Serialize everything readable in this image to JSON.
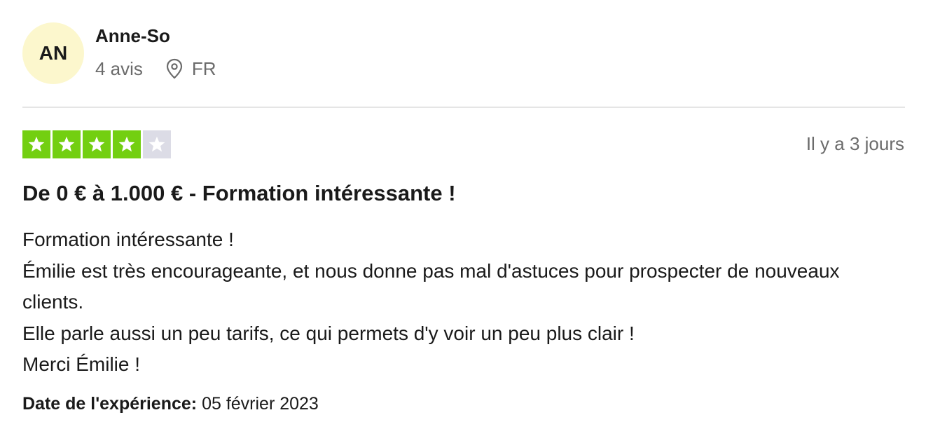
{
  "reviewer": {
    "initials": "AN",
    "name": "Anne-So",
    "review_count": "4 avis",
    "country": "FR",
    "location_icon": "location-pin-icon",
    "avatar_color": "#fcf7cd"
  },
  "rating": {
    "value": 4,
    "max": 5,
    "filled_color": "#73cf11",
    "empty_color": "#dcdce6"
  },
  "review": {
    "relative_date": "Il y a 3 jours",
    "title": "De 0 € à 1.000 € - Formation intéressante !",
    "body_lines": [
      "Formation intéressante !",
      "Émilie est très encourageante, et nous donne pas mal d'astuces pour prospecter de nouveaux clients.",
      "Elle parle aussi un peu tarifs, ce qui permets d'y voir un peu plus clair !",
      "Merci Émilie !"
    ],
    "experience_label": "Date de l'expérience:",
    "experience_date": "05 février 2023"
  }
}
